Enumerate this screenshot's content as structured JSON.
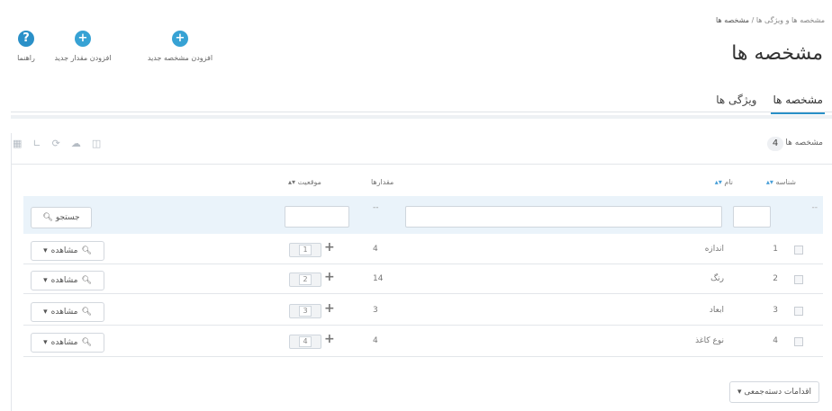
{
  "toolbar": {
    "help_label": "راهنما",
    "add_value_label": "افزودن مقدار جدید",
    "add_feature_label": "افزودن مشخصه جدید"
  },
  "breadcrumb": {
    "parent": "مشخصه ها و ویژگی ها",
    "separator": "/",
    "current": "مشخصه ها"
  },
  "page_title": "مشخصه ها",
  "tabs": [
    {
      "label": "مشخصه ها",
      "active": true
    },
    {
      "label": "ویژگی ها",
      "active": false
    }
  ],
  "panel": {
    "label": "مشخصه ها",
    "count": "4"
  },
  "columns": {
    "id": "شناسه",
    "name": "نام",
    "values": "مقدارها",
    "position": "موقعیت"
  },
  "filter": {
    "search_label": "جستجو",
    "values_placeholder": "--"
  },
  "rows": [
    {
      "id": "1",
      "name": "اندازه",
      "values": "4",
      "position": "1",
      "view": "مشاهده"
    },
    {
      "id": "2",
      "name": "رنگ",
      "values": "14",
      "position": "2",
      "view": "مشاهده"
    },
    {
      "id": "3",
      "name": "ابعاد",
      "values": "3",
      "position": "3",
      "view": "مشاهده"
    },
    {
      "id": "4",
      "name": "نوع کاغذ",
      "values": "4",
      "position": "4",
      "view": "مشاهده"
    }
  ],
  "bulk_actions_label": "اقدامات دسته‌جمعی",
  "colors": {
    "accent": "#2a90c8",
    "filter_bg": "#eaf3fa"
  }
}
